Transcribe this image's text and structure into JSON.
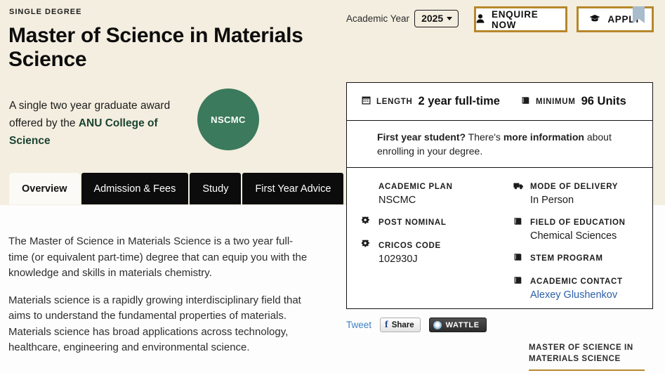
{
  "hero": {
    "kicker": "SINGLE DEGREE",
    "title": "Master of Science in Materials Science",
    "subtitle_lead": "A single two year graduate award offered by the ",
    "subtitle_link": "ANU College of Science",
    "badge_code": "NSCMC"
  },
  "academic_year": {
    "label": "Academic Year",
    "value": "2025",
    "caret_icon": "chevron-down-icon"
  },
  "cta": {
    "enquire_label": "ENQUIRE NOW",
    "enquire_icon": "person-icon",
    "apply_label": "APPLY",
    "apply_icon": "graduation-cap-icon",
    "bookmark_icon": "bookmark-icon",
    "border_color": "#b7872b"
  },
  "tabs": [
    {
      "label": "Overview",
      "active": true
    },
    {
      "label": "Admission & Fees",
      "active": false
    },
    {
      "label": "Study",
      "active": false
    },
    {
      "label": "First Year Advice",
      "active": false
    }
  ],
  "body": {
    "paragraph_1": "The Master of Science in Materials Science is a two year full-time (or equivalent part-time) degree that can equip you with the knowledge and skills in materials chemistry.",
    "paragraph_2": "Materials science is a rapidly growing interdisciplinary field that aims to understand the fundamental properties of materials. Materials science has broad applications across technology, healthcare, engineering and environmental science."
  },
  "info_card": {
    "stats": [
      {
        "icon": "calendar-icon",
        "label": "LENGTH",
        "value": "2 year full-time"
      },
      {
        "icon": "book-icon",
        "label": "MINIMUM",
        "value": "96 Units"
      }
    ],
    "note": {
      "bold_lead": "First year student?",
      "middle": " There's ",
      "bold_link": "more information",
      "tail": " about enrolling in your degree."
    },
    "left_fields": [
      {
        "icon": "",
        "label": "ACADEMIC PLAN",
        "value": "NSCMC"
      },
      {
        "icon": "gear-icon",
        "label": "POST NOMINAL",
        "value": ""
      },
      {
        "icon": "gear-icon",
        "label": "CRICOS CODE",
        "value": "102930J"
      }
    ],
    "right_fields": [
      {
        "icon": "truck-icon",
        "label": "MODE OF DELIVERY",
        "value": "In Person",
        "link": false
      },
      {
        "icon": "book-icon",
        "label": "FIELD OF EDUCATION",
        "value": "Chemical Sciences",
        "link": false
      },
      {
        "icon": "book-icon",
        "label": "STEM PROGRAM",
        "value": "",
        "link": false
      },
      {
        "icon": "book-icon",
        "label": "ACADEMIC CONTACT",
        "value": "Alexey Glushenkov",
        "link": true
      }
    ]
  },
  "share": {
    "tweet_label": "Tweet",
    "facebook_label": "Share",
    "facebook_icon": "facebook-icon",
    "wattle_label": "WATTLE",
    "wattle_icon": "wattle-icon"
  },
  "footer_heading": {
    "line_1": "MASTER OF SCIENCE IN",
    "line_2": "MATERIALS SCIENCE",
    "rule_color": "#b7872b"
  }
}
